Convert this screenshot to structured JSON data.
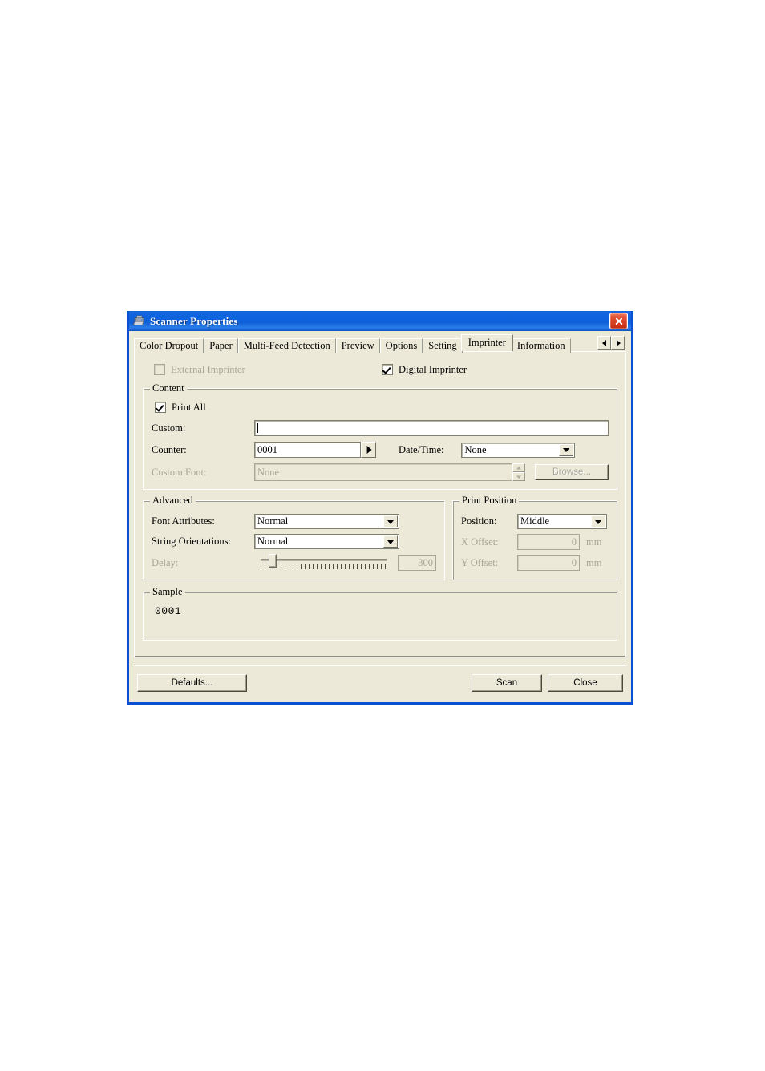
{
  "window": {
    "title": "Scanner Properties",
    "icon": "scanner-icon",
    "close_label": "",
    "accent_title_color": "#0f62dd",
    "dialog_bg": "#ece9d8",
    "border_color": "#0a50d2"
  },
  "tabs": {
    "items": [
      {
        "label": "Color Dropout",
        "active": false
      },
      {
        "label": "Paper",
        "active": false
      },
      {
        "label": "Multi-Feed Detection",
        "active": false
      },
      {
        "label": "Preview",
        "active": false
      },
      {
        "label": "Options",
        "active": false
      },
      {
        "label": "Setting",
        "active": false
      },
      {
        "label": "Imprinter",
        "active": true
      },
      {
        "label": "Information",
        "active": false
      }
    ],
    "scroll_left": "◄",
    "scroll_right": "►"
  },
  "imprinter": {
    "external_label": "External Imprinter",
    "external_checked": false,
    "external_enabled": false,
    "digital_label": "Digital Imprinter",
    "digital_checked": true,
    "digital_enabled": true
  },
  "content": {
    "legend": "Content",
    "print_all_label": "Print All",
    "print_all_checked": true,
    "custom_label": "Custom:",
    "custom_value": "",
    "counter_label": "Counter:",
    "counter_value": "0001",
    "datetime_label": "Date/Time:",
    "datetime_value": "None",
    "custom_font_label": "Custom Font:",
    "custom_font_value": "None",
    "browse_label": "Browse..."
  },
  "advanced": {
    "legend": "Advanced",
    "font_attributes_label": "Font Attributes:",
    "font_attributes_value": "Normal",
    "string_orientations_label": "String Orientations:",
    "string_orientations_value": "Normal",
    "delay_label": "Delay:",
    "delay_value": "300"
  },
  "print_position": {
    "legend": "Print Position",
    "position_label": "Position:",
    "position_value": "Middle",
    "x_offset_label": "X Offset:",
    "x_offset_value": "0",
    "x_offset_unit": "mm",
    "y_offset_label": "Y Offset:",
    "y_offset_value": "0",
    "y_offset_unit": "mm"
  },
  "sample": {
    "legend": "Sample",
    "value": "0001"
  },
  "footer": {
    "defaults_label": "Defaults...",
    "scan_label": "Scan",
    "close_label": "Close"
  }
}
